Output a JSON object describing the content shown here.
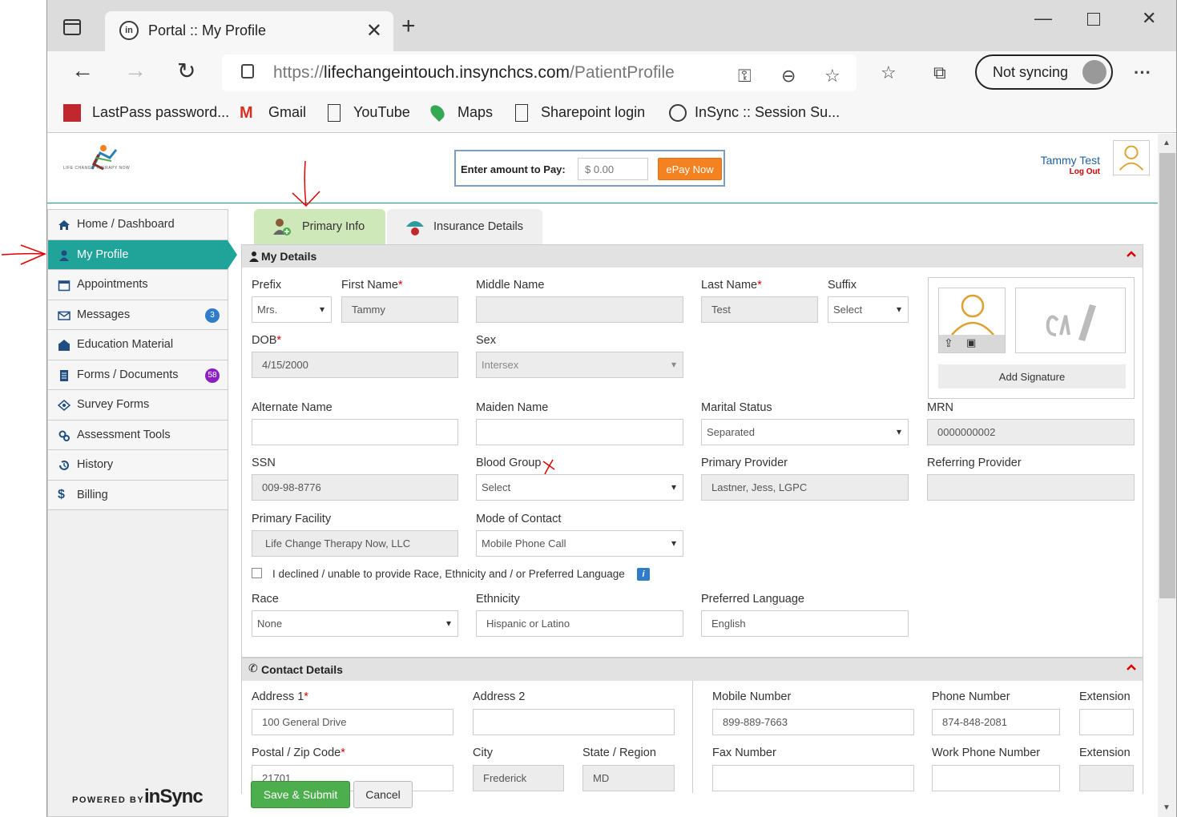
{
  "browser": {
    "tab_title": "Portal :: My Profile",
    "tab_favicon": "in",
    "url_prefix": "https://",
    "url_domain": "lifechangeintouch.insynchcs.com",
    "url_path": "/PatientProfile",
    "sync_label": "Not syncing",
    "bookmarks": [
      "LastPass password...",
      "Gmail",
      "YouTube",
      "Maps",
      "Sharepoint login",
      "InSync :: Session Su..."
    ]
  },
  "header": {
    "logo_text": "LIFE CHANGE THERAPY NOW",
    "pay_label": "Enter amount to Pay:",
    "pay_placeholder": "$ 0.00",
    "pay_button": "ePay Now",
    "user_name": "Tammy Test",
    "logout": "Log Out"
  },
  "sidebar": {
    "items": [
      {
        "label": "Home / Dashboard",
        "icon": "home-icon"
      },
      {
        "label": "My Profile",
        "icon": "user-icon"
      },
      {
        "label": "Appointments",
        "icon": "calendar-icon"
      },
      {
        "label": "Messages",
        "icon": "envelope-icon",
        "badge": "3"
      },
      {
        "label": "Education Material",
        "icon": "books-icon"
      },
      {
        "label": "Forms / Documents",
        "icon": "document-icon",
        "badge": "58"
      },
      {
        "label": "Survey Forms",
        "icon": "survey-icon"
      },
      {
        "label": "Assessment Tools",
        "icon": "tools-icon"
      },
      {
        "label": "History",
        "icon": "history-icon"
      },
      {
        "label": "Billing",
        "icon": "dollar-icon"
      }
    ],
    "powered_by": "POWERED BY",
    "powered_logo": "inSync"
  },
  "tabs": {
    "primary": "Primary Info",
    "insurance": "Insurance Details"
  },
  "my_details": {
    "title": "My Details",
    "prefix_label": "Prefix",
    "prefix_value": "Mrs.",
    "first_name_label": "First Name",
    "first_name_value": "Tammy",
    "middle_name_label": "Middle Name",
    "middle_name_value": "",
    "last_name_label": "Last Name",
    "last_name_value": "Test",
    "suffix_label": "Suffix",
    "suffix_value": "Select",
    "dob_label": "DOB",
    "dob_value": "4/15/2000",
    "sex_label": "Sex",
    "sex_value": "Intersex",
    "alt_name_label": "Alternate Name",
    "alt_name_value": "",
    "maiden_name_label": "Maiden Name",
    "maiden_name_value": "",
    "marital_label": "Marital Status",
    "marital_value": "Separated",
    "mrn_label": "MRN",
    "mrn_value": "0000000002",
    "ssn_label": "SSN",
    "ssn_value": "009-98-8776",
    "blood_label": "Blood Group",
    "blood_value": "Select",
    "primary_provider_label": "Primary Provider",
    "primary_provider_value": "Lastner, Jess, LGPC",
    "referring_provider_label": "Referring Provider",
    "referring_provider_value": "",
    "facility_label": "Primary Facility",
    "facility_value": "Life Change Therapy Now, LLC",
    "contact_mode_label": "Mode of Contact",
    "contact_mode_value": "Mobile Phone Call",
    "decline_text": "I declined / unable to provide Race, Ethnicity and / or Preferred Language",
    "race_label": "Race",
    "race_value": "None",
    "ethnicity_label": "Ethnicity",
    "ethnicity_value": "Hispanic or Latino",
    "language_label": "Preferred Language",
    "language_value": "English",
    "add_signature": "Add Signature"
  },
  "contact": {
    "title": "Contact Details",
    "address1_label": "Address 1",
    "address1_value": "100 General Drive",
    "address2_label": "Address 2",
    "address2_value": "",
    "mobile_label": "Mobile Number",
    "mobile_value": "899-889-7663",
    "phone_label": "Phone Number",
    "phone_value": "874-848-2081",
    "extension_label": "Extension",
    "extension_value": "",
    "zip_label": "Postal / Zip Code",
    "zip_value": "21701",
    "city_label": "City",
    "city_value": "Frederick",
    "state_label": "State / Region",
    "state_value": "MD",
    "fax_label": "Fax Number",
    "fax_value": "",
    "work_phone_label": "Work Phone Number",
    "work_phone_value": "",
    "extension2_label": "Extension",
    "extension2_value": ""
  },
  "actions": {
    "save": "Save & Submit",
    "cancel": "Cancel"
  },
  "colors": {
    "accent": "#20a49a",
    "epay": "#f58220",
    "save": "#4cae4c",
    "annotation": "#e00000"
  }
}
